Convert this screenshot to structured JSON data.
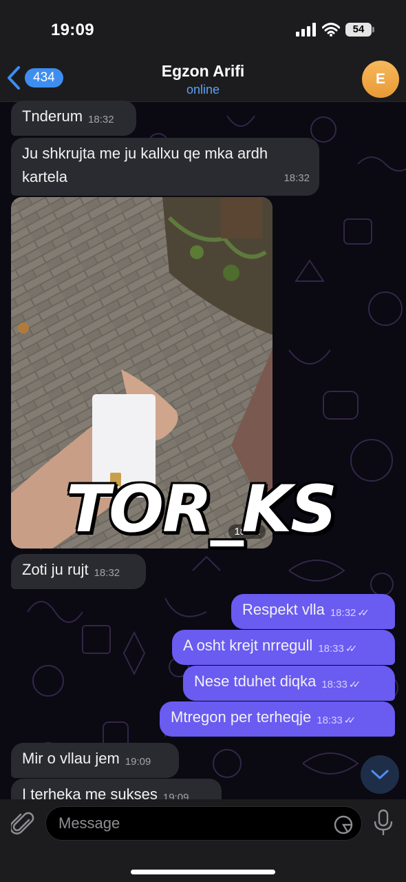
{
  "status_bar": {
    "time": "19:09",
    "battery": "54"
  },
  "header": {
    "back_count": "434",
    "name": "Egzon Arifi",
    "status": "online",
    "avatar_letter": "E"
  },
  "messages": [
    {
      "text": "Tnderum",
      "time": "18:32"
    },
    {
      "text": "Ju shkrujta me ju kallxu qe mka ardh kartela",
      "line1": "Ju shkrujta me ju kallxu qe mka ardh",
      "line2": "kartela",
      "time": "18:32"
    },
    {
      "photo_time": "18:32"
    },
    {
      "text": "Zoti ju rujt",
      "time": "18:32"
    },
    {
      "text": "Respekt vlla",
      "time": "18:32"
    },
    {
      "text": "A osht krejt nrregull",
      "time": "18:33"
    },
    {
      "text": "Nese tduhet diqka",
      "time": "18:33"
    },
    {
      "text": "Mtregon per terheqje",
      "time": "18:33"
    },
    {
      "text": "Mir o vllau jem",
      "time": "19:09"
    },
    {
      "text": "I terheka me sukses",
      "time": "19:09"
    }
  ],
  "watermark": "TOR_KS",
  "input": {
    "placeholder": "Message"
  },
  "colors": {
    "outgoing": "#6a5bf1",
    "incoming": "#2a2b31",
    "accent": "#3d8ef0",
    "avatar": "#f0a845"
  },
  "icons": [
    "back-chevron-icon",
    "signal-icon",
    "wifi-icon",
    "battery-icon",
    "paperclip-icon",
    "sticker-icon",
    "microphone-icon",
    "chevron-down-icon",
    "double-check-icon"
  ]
}
